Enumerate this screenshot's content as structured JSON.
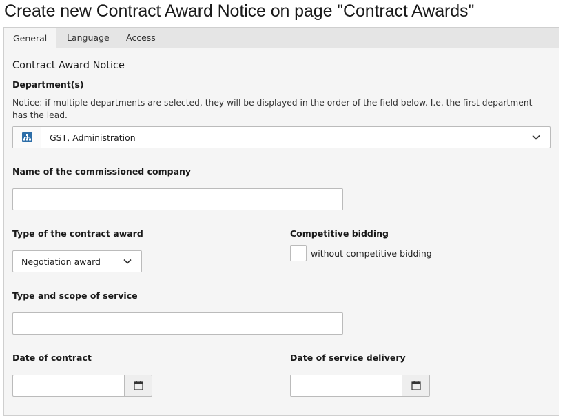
{
  "page": {
    "title": "Create new Contract Award Notice on page \"Contract Awards\""
  },
  "tabs": [
    {
      "label": "General",
      "active": true
    },
    {
      "label": "Language",
      "active": false
    },
    {
      "label": "Access",
      "active": false
    }
  ],
  "form": {
    "section_header": "Contract Award Notice",
    "departments": {
      "label": "Department(s)",
      "notice": "Notice: if multiple departments are selected, they will be displayed in the order of the field below. I.e. the first department has the lead.",
      "selected": "GST, Administration",
      "icon": "org-chart-icon",
      "icon_color": "#2d6ea8"
    },
    "company_name": {
      "label": "Name of the commissioned company",
      "value": ""
    },
    "award_type": {
      "label": "Type of the contract award",
      "selected": "Negotiation award"
    },
    "competitive_bidding": {
      "label": "Competitive bidding",
      "checkbox_label": "without competitive bidding",
      "checked": false
    },
    "service_scope": {
      "label": "Type and scope of service",
      "value": ""
    },
    "contract_date": {
      "label": "Date of contract",
      "value": ""
    },
    "delivery_date": {
      "label": "Date of service delivery",
      "value": ""
    }
  }
}
